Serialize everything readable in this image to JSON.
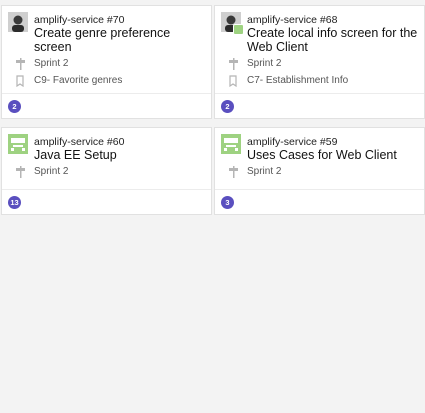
{
  "cards": [
    {
      "work_id": "amplify-service #70",
      "title": "Create genre preference screen",
      "iteration": "Sprint 2",
      "area": "C9- Favorite genres",
      "count": "2"
    },
    {
      "work_id": "amplify-service #68",
      "title": "Create local info screen for the Web Client",
      "iteration": "Sprint 2",
      "area": "C7- Establishment Info",
      "count": "2"
    },
    {
      "work_id": "amplify-service #60",
      "title": "Java EE Setup",
      "iteration": "Sprint 2",
      "count": "13"
    },
    {
      "work_id": "amplify-service #59",
      "title": "Uses Cases for Web Client",
      "iteration": "Sprint 2",
      "count": "3"
    }
  ],
  "colors": {
    "badge": "#5a4fbf",
    "bot_avatar": "#9ed281",
    "card_border": "#e1e1e1",
    "background": "#f3f3f3"
  }
}
